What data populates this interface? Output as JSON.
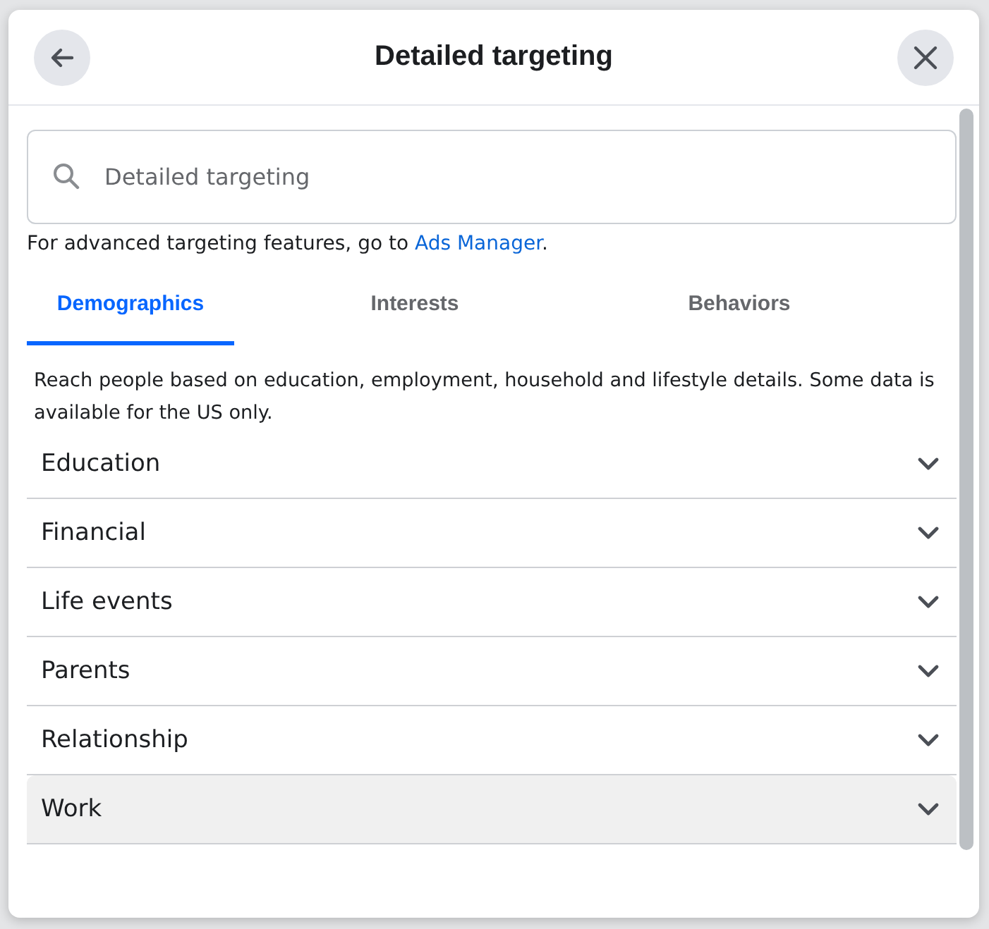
{
  "dialog": {
    "title": "Detailed targeting"
  },
  "search": {
    "placeholder": "Detailed targeting"
  },
  "helper": {
    "text": "For advanced targeting features, go to ",
    "link": "Ads Manager",
    "after": "."
  },
  "tabs": [
    {
      "label": "Demographics",
      "selected": true
    },
    {
      "label": "Interests",
      "selected": false
    },
    {
      "label": "Behaviors",
      "selected": false
    }
  ],
  "description": "Reach people based on education, employment, household and lifestyle details. Some data is available for the US only.",
  "categories": [
    {
      "label": "Education",
      "expanded": false,
      "highlighted": false
    },
    {
      "label": "Financial",
      "expanded": false,
      "highlighted": false
    },
    {
      "label": "Life events",
      "expanded": false,
      "highlighted": false
    },
    {
      "label": "Parents",
      "expanded": false,
      "highlighted": false
    },
    {
      "label": "Relationship",
      "expanded": false,
      "highlighted": false
    },
    {
      "label": "Work",
      "expanded": false,
      "highlighted": true
    }
  ]
}
